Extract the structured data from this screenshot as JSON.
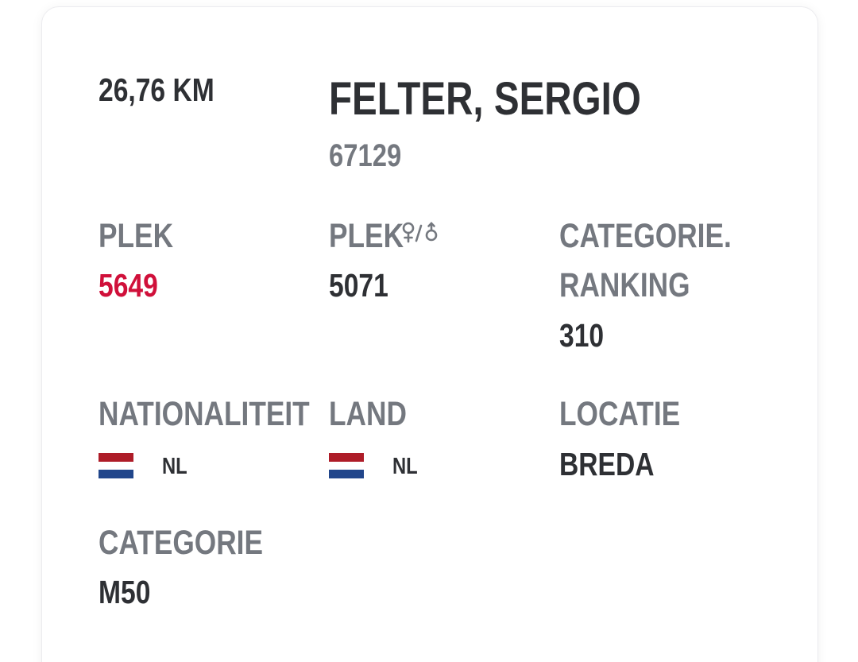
{
  "result": {
    "distance": "26,76 KM",
    "name": "FELTER, SERGIO",
    "bib": "67129"
  },
  "stats": {
    "place": {
      "label": "PLEK",
      "value": "5649"
    },
    "place_gender": {
      "label": "PLEK",
      "value": "5071",
      "icon": "gender-female-male-icon"
    },
    "category_ranking": {
      "label_line1": "CATEGORIE.",
      "label_line2": "RANKING",
      "value": "310"
    },
    "nationality": {
      "label": "NATIONALITEIT",
      "code": "NL",
      "flag": "netherlands-flag"
    },
    "country": {
      "label": "LAND",
      "code": "NL",
      "flag": "netherlands-flag"
    },
    "location": {
      "label": "LOCATIE",
      "value": "BREDA"
    },
    "category": {
      "label": "CATEGORIE",
      "value": "M50"
    }
  },
  "colors": {
    "place_highlight": "#d0103a",
    "label_gray": "#74787f",
    "value_dark": "#2e3034",
    "flag_red": "#ae1c28",
    "flag_white": "#ffffff",
    "flag_blue": "#21468b"
  }
}
